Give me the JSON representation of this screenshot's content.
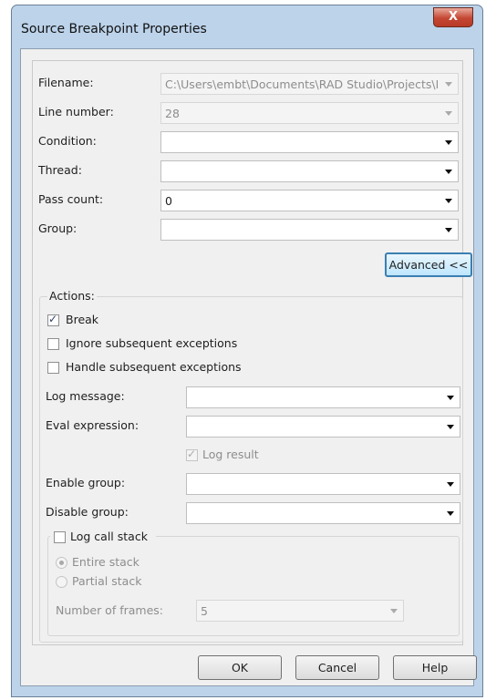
{
  "window": {
    "title": "Source Breakpoint Properties",
    "close_glyph": "X"
  },
  "fields": {
    "filename": {
      "label": "Filename:",
      "value": "C:\\Users\\embt\\Documents\\RAD Studio\\Projects\\L"
    },
    "line_number": {
      "label": "Line number:",
      "value": "28"
    },
    "condition": {
      "label": "Condition:",
      "value": ""
    },
    "thread": {
      "label": "Thread:",
      "value": ""
    },
    "pass_count": {
      "label": "Pass count:",
      "value": "0"
    },
    "group": {
      "label": "Group:",
      "value": ""
    }
  },
  "advanced_button": "Advanced <<",
  "actions": {
    "caption": "Actions:",
    "break": {
      "label": "Break",
      "checked": true
    },
    "ignore_exceptions": {
      "label": "Ignore subsequent exceptions",
      "checked": false
    },
    "handle_exceptions": {
      "label": "Handle subsequent exceptions",
      "checked": false
    },
    "log_message": {
      "label": "Log message:",
      "value": ""
    },
    "eval_expression": {
      "label": "Eval expression:",
      "value": ""
    },
    "log_result": {
      "label": "Log result",
      "checked": true
    },
    "enable_group": {
      "label": "Enable group:",
      "value": ""
    },
    "disable_group": {
      "label": "Disable group:",
      "value": ""
    },
    "log_call_stack": {
      "label": "Log call stack",
      "checked": false
    },
    "entire_stack": {
      "label": "Entire stack",
      "selected": true
    },
    "partial_stack": {
      "label": "Partial stack",
      "selected": false
    },
    "number_of_frames": {
      "label": "Number of frames:",
      "value": "5"
    }
  },
  "buttons": {
    "ok": "OK",
    "cancel": "Cancel",
    "help": "Help"
  },
  "colors": {
    "title_bar": "#bcd3ea",
    "dialog_bg": "#f0f0f0",
    "close_button": "#c44733",
    "advanced_border": "#3c7fb1"
  }
}
